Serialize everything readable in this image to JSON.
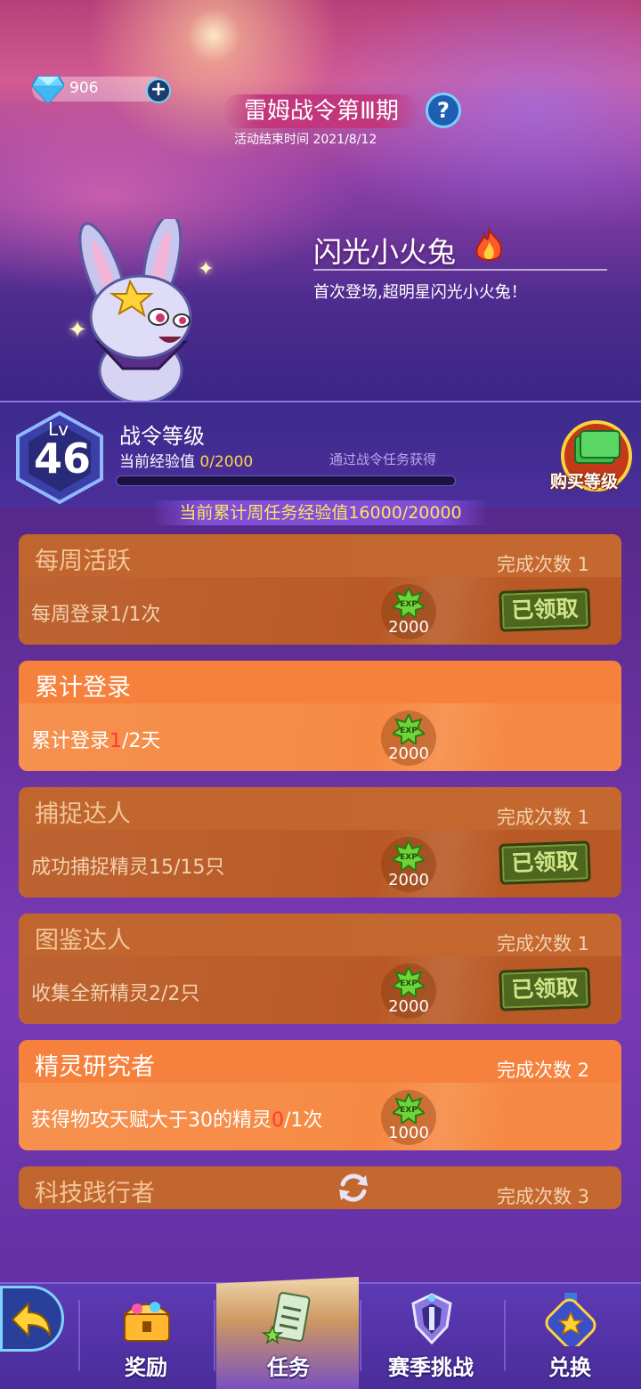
{
  "header": {
    "gems": "906",
    "season_title": "雷姆战令第Ⅲ期",
    "season_end": "活动结束时间 2021/8/12",
    "help_symbol": "?"
  },
  "featured_pet": {
    "name": "闪光小火兔",
    "description": "首次登场,超明星闪光小火兔！"
  },
  "level": {
    "lv_label": "Lv",
    "lv_value": "46",
    "title": "战令等级",
    "exp_label": "当前经验值",
    "exp_value": "0/2000",
    "exp_fraction": 0.0,
    "exp_hint": "通过战令任务获得",
    "buy_label": "购买等级"
  },
  "weekly_progress": "当前累计周任务经验值16000/20000",
  "tasks": [
    {
      "title": "每周活跃",
      "count": "完成次数 1",
      "desc_pre": "每周登录1/1次",
      "desc_hl": "",
      "desc_post": "",
      "exp": "2000",
      "claimed": "已领取"
    },
    {
      "title": "累计登录",
      "count": "",
      "desc_pre": "累计登录",
      "desc_hl": "1",
      "desc_post": "/2天",
      "exp": "2000",
      "claimed": ""
    },
    {
      "title": "捕捉达人",
      "count": "完成次数 1",
      "desc_pre": "成功捕捉精灵15/15只",
      "desc_hl": "",
      "desc_post": "",
      "exp": "2000",
      "claimed": "已领取"
    },
    {
      "title": "图鉴达人",
      "count": "完成次数 1",
      "desc_pre": "收集全新精灵2/2只",
      "desc_hl": "",
      "desc_post": "",
      "exp": "2000",
      "claimed": "已领取"
    },
    {
      "title": "精灵研究者",
      "count": "完成次数 2",
      "desc_pre": "获得物攻天赋大于30的精灵",
      "desc_hl": "0",
      "desc_post": "/1次",
      "exp": "1000",
      "claimed": ""
    },
    {
      "title": "科技践行者",
      "count": "完成次数 3"
    }
  ],
  "exp_icon_text": "EXP",
  "nav": {
    "rewards": "奖励",
    "tasks": "任务",
    "season_challenge": "赛季挑战",
    "exchange": "兑换"
  },
  "colors": {
    "accent_gold": "#ffd34a",
    "task_active": "#f0793a",
    "task_done": "#c1612b",
    "highlight_red": "#ff3b2f"
  }
}
